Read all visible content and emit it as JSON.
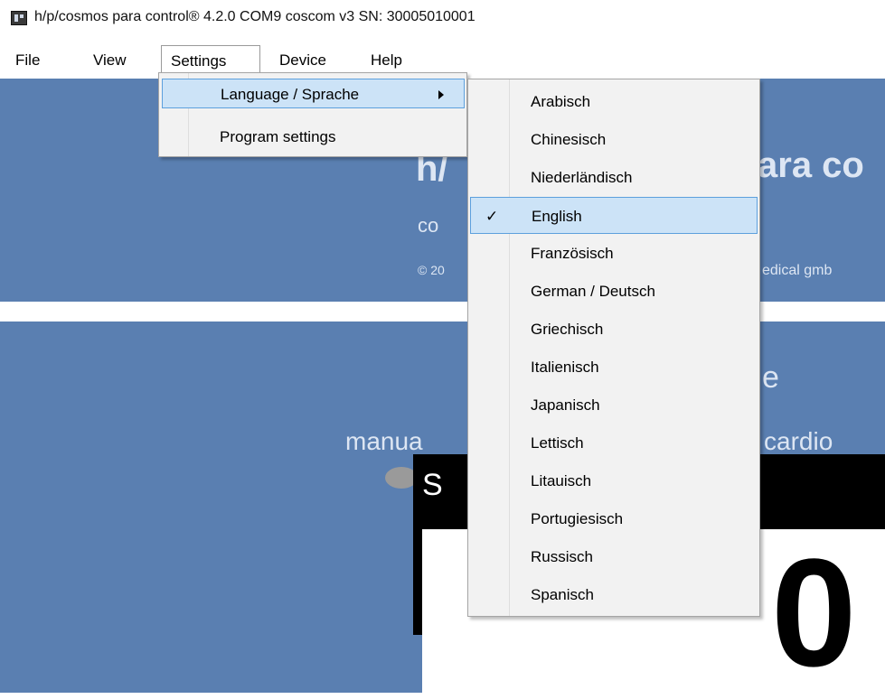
{
  "window": {
    "title": "h/p/cosmos para control® 4.2.0 COM9 coscom v3  SN: 30005010001",
    "icon": "app-icon"
  },
  "menubar": {
    "items": [
      {
        "name": "file",
        "label": "File"
      },
      {
        "name": "view",
        "label": "View"
      },
      {
        "name": "settings",
        "label": "Settings",
        "open": true
      },
      {
        "name": "device",
        "label": "Device"
      },
      {
        "name": "help",
        "label": "Help"
      }
    ]
  },
  "settings_menu": {
    "items": [
      {
        "label": "Language / Sprache",
        "has_submenu": true,
        "highlighted": true
      },
      {
        "label": "Program settings"
      }
    ]
  },
  "language_submenu": {
    "items": [
      {
        "label": "Arabisch"
      },
      {
        "label": "Chinesisch"
      },
      {
        "label": "Niederländisch"
      },
      {
        "label": "English",
        "checked": true
      },
      {
        "label": "Französisch"
      },
      {
        "label": "German / Deutsch"
      },
      {
        "label": "Griechisch"
      },
      {
        "label": "Italienisch"
      },
      {
        "label": "Japanisch"
      },
      {
        "label": "Lettisch"
      },
      {
        "label": "Litauisch"
      },
      {
        "label": "Portugiesisch"
      },
      {
        "label": "Russisch"
      },
      {
        "label": "Spanisch"
      }
    ],
    "check_glyph": "✓"
  },
  "background": {
    "banner_visible_a": "h/",
    "banner_visible_b": "ara co",
    "subtitle_visible": "co",
    "copyright_visible_a": "© 20",
    "copyright_visible_b": "edical gmb",
    "mode_visible": "e",
    "mode_left": "manua",
    "mode_right": "cardio",
    "display_letter": "S",
    "display_digit": "0"
  },
  "colors": {
    "app_background": "#5a7fb1",
    "menu_background": "#f2f2f2",
    "highlight": "#cce3f7",
    "highlight_border": "#5da0dd"
  }
}
